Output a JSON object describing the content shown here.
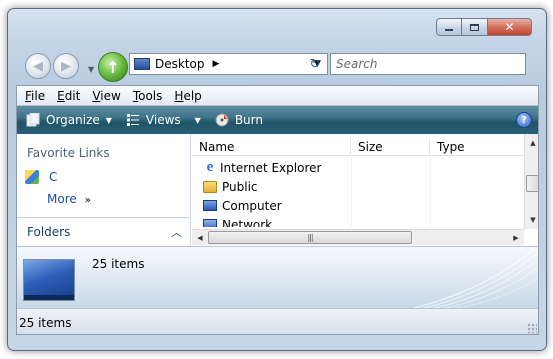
{
  "window": {
    "caption": {
      "min_icon": "minimize-icon",
      "max_icon": "maximize-icon",
      "close_glyph": "✕"
    }
  },
  "navigation": {
    "back_glyph": "◀",
    "forward_glyph": "▶",
    "history_glyph": "▼",
    "go_glyph": "↑",
    "address": {
      "location": "Desktop",
      "breadcrumb_arrow": "▶",
      "dropdown_glyph": "▼"
    },
    "refresh_glyph": "↻",
    "search": {
      "placeholder": "Search"
    }
  },
  "menubar": {
    "items": [
      {
        "key": "F",
        "rest": "ile"
      },
      {
        "key": "E",
        "rest": "dit"
      },
      {
        "key": "V",
        "rest": "iew"
      },
      {
        "key": "T",
        "rest": "ools"
      },
      {
        "key": "H",
        "rest": "elp"
      }
    ]
  },
  "commandbar": {
    "organize": "Organize",
    "views": "Views",
    "burn": "Burn",
    "dropdown_glyph": "▼",
    "help_glyph": "?"
  },
  "leftpane": {
    "favorite_links_title": "Favorite Links",
    "links": [
      {
        "label": "C"
      }
    ],
    "more_label": "More",
    "more_glyph": "»",
    "folders_label": "Folders",
    "folders_glyph": "︿"
  },
  "filelist": {
    "columns": [
      "Name",
      "Size",
      "Type"
    ],
    "rows": [
      {
        "name": "Internet Explorer",
        "icon": "internet-explorer-icon"
      },
      {
        "name": "Public",
        "icon": "folder-icon"
      },
      {
        "name": "Computer",
        "icon": "computer-icon"
      },
      {
        "name": "Network",
        "icon": "network-icon"
      }
    ],
    "ie_glyph": "e",
    "scroll_up": "▲",
    "scroll_down": "▼",
    "scroll_left": "◀",
    "scroll_right": "▶",
    "thumb_grip": "|||"
  },
  "details": {
    "item_count": "25 items"
  },
  "statusbar": {
    "item_count": "25 items"
  },
  "colors": {
    "command_bar": "#2a6177",
    "link_blue": "#1a4fa6"
  }
}
